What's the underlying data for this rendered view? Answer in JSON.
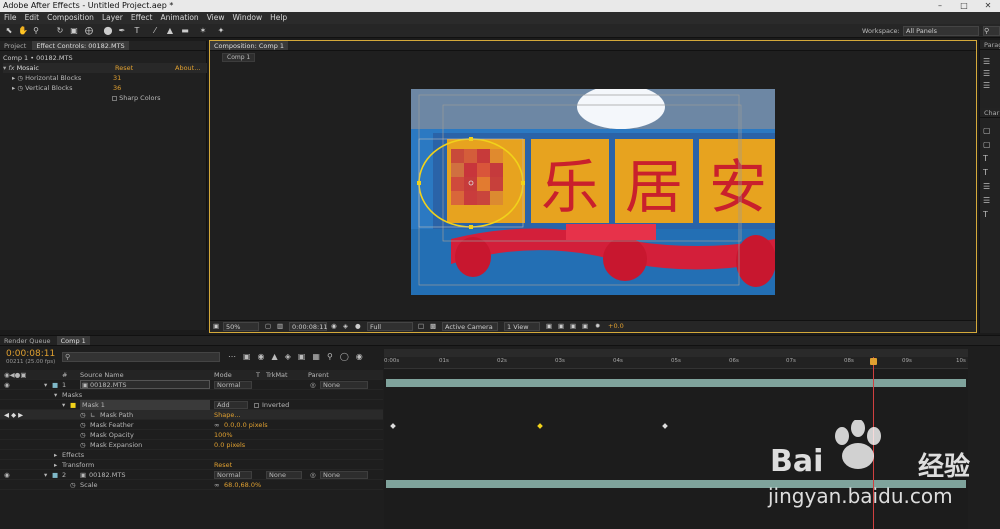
{
  "window": {
    "title": "Adobe After Effects - Untitled Project.aep *"
  },
  "menu": [
    "File",
    "Edit",
    "Composition",
    "Layer",
    "Effect",
    "Animation",
    "View",
    "Window",
    "Help"
  ],
  "toolbar": {
    "workspace_label": "Workspace:",
    "workspace_value": "All Panels"
  },
  "effect_controls": {
    "tab_project": "Project",
    "tab_effect": "Effect Controls: 00182.MTS",
    "header": "Comp 1 • 00182.MTS",
    "effect_name": "Mosaic",
    "reset": "Reset",
    "about": "About...",
    "props": [
      {
        "name": "Horizontal Blocks",
        "value": "31"
      },
      {
        "name": "Vertical Blocks",
        "value": "36"
      }
    ],
    "sharp_colors": "Sharp Colors"
  },
  "composition": {
    "tab": "Composition: Comp 1",
    "crumb": "Comp 1",
    "sign_text": [
      "乐",
      "居",
      "安"
    ],
    "bottom": {
      "zoom": "50%",
      "time": "0:00:08:11",
      "resolution": "Full",
      "camera": "Active Camera",
      "views": "1 View",
      "exposure": "+0.0"
    }
  },
  "right_panel": {
    "tab1": "Parag",
    "tab2": "Char"
  },
  "timeline": {
    "tab_render": "Render Queue",
    "tab_comp": "Comp 1",
    "timecode": "0:00:08:11",
    "timecode_sub": "00211 (25.00 fps)",
    "search_placeholder": "",
    "headers": {
      "num": "#",
      "source": "Source Name",
      "mode": "Mode",
      "t": "T",
      "trkmat": "TrkMat",
      "parent": "Parent"
    },
    "ruler": [
      "0:00s",
      "01s",
      "02s",
      "03s",
      "04s",
      "05s",
      "06s",
      "07s",
      "08s",
      "09s",
      "10s"
    ],
    "layer1": {
      "num": "1",
      "name": "00182.MTS",
      "mode": "Normal",
      "parent": "None"
    },
    "masks_label": "Masks",
    "mask1": {
      "name": "Mask 1",
      "mode": "Add",
      "inverted": "Inverted"
    },
    "mask_props": [
      {
        "name": "Mask Path",
        "value": "Shape..."
      },
      {
        "name": "Mask Feather",
        "value": "0.0,0.0 pixels"
      },
      {
        "name": "Mask Opacity",
        "value": "100%"
      },
      {
        "name": "Mask Expansion",
        "value": "0.0 pixels"
      }
    ],
    "effects_label": "Effects",
    "transform_label": "Transform",
    "transform_reset": "Reset",
    "layer2": {
      "num": "2",
      "name": "00182.MTS",
      "mode": "Normal",
      "trkmat": "None",
      "parent": "None"
    },
    "scale": {
      "name": "Scale",
      "value": "68.0,68.0%"
    }
  },
  "watermark": {
    "logo": "Bai",
    "logo_cn": "经验",
    "url": "jingyan.baidu.com"
  }
}
